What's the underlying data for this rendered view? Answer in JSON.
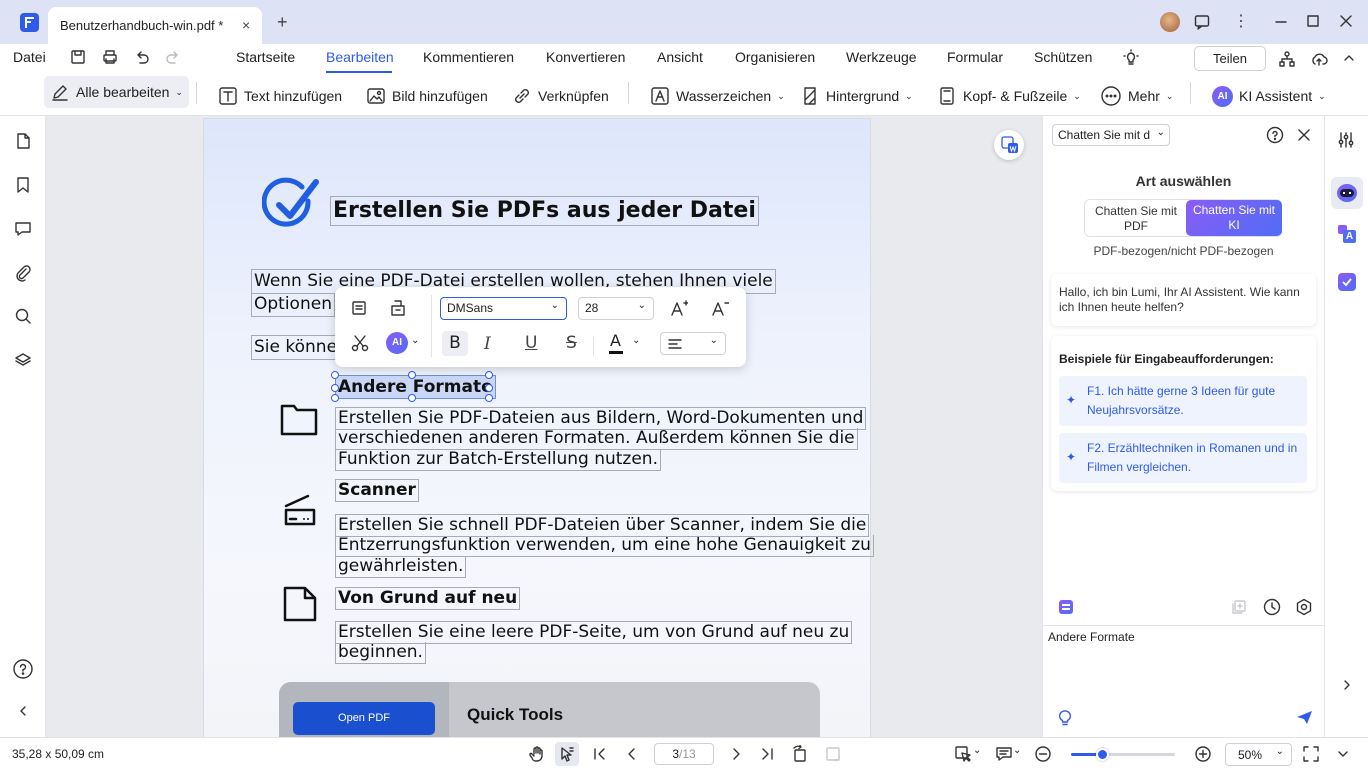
{
  "window": {
    "tab_title": "Benutzerhandbuch-win.pdf *",
    "tab_close": "×",
    "new_tab": "+"
  },
  "menu": {
    "file": "Datei",
    "items": [
      "Startseite",
      "Bearbeiten",
      "Kommentieren",
      "Konvertieren",
      "Ansicht",
      "Organisieren",
      "Werkzeuge",
      "Formular",
      "Schützen"
    ],
    "active": "Bearbeiten",
    "share": "Teilen"
  },
  "toolbar": {
    "edit_all": "Alle bearbeiten",
    "add_text": "Text hinzufügen",
    "add_image": "Bild hinzufügen",
    "link": "Verknüpfen",
    "watermark": "Wasserzeichen",
    "background": "Hintergrund",
    "header_footer": "Kopf- & Fußzeile",
    "more": "Mehr",
    "ai_assistant": "KI Assistent",
    "ai_badge": "AI"
  },
  "document": {
    "title": "Erstellen Sie PDFs aus jeder Datei",
    "intro_line1": "Wenn Sie eine PDF-Datei erstellen wollen, stehen Ihnen viele",
    "intro_line2": "Optionen",
    "intro_line3": "Sie könne",
    "sections": [
      {
        "heading": "Andere Formate",
        "lines": [
          "Erstellen Sie PDF-Dateien aus Bildern, Word-Dokumenten und",
          "verschiedenen anderen Formaten. Außerdem können Sie die",
          "Funktion zur Batch-Erstellung nutzen."
        ]
      },
      {
        "heading": "Scanner",
        "lines": [
          "Erstellen Sie schnell PDF-Dateien über Scanner, indem Sie die",
          "Entzerrungsfunktion verwenden, um eine hohe Genauigkeit zu",
          "gewährleisten."
        ]
      },
      {
        "heading": "Von Grund auf neu",
        "lines": [
          "Erstellen Sie eine leere PDF-Seite, um von Grund auf neu zu",
          "beginnen."
        ]
      }
    ],
    "quick_tools_title": "Quick Tools",
    "open_pdf_button": "Open PDF"
  },
  "format_toolbar": {
    "font": "DMSans",
    "size": "28",
    "ai_badge": "AI",
    "bold": "B",
    "italic": "I",
    "underline": "U",
    "strike": "S",
    "text_color": "A"
  },
  "ai_panel": {
    "mode_select": "Chatten Sie mit d",
    "choose_type": "Art auswählen",
    "option_pdf": "Chatten Sie mit PDF",
    "option_ai": "Chatten Sie mit KI",
    "subtitle": "PDF-bezogen/nicht PDF-bezogen",
    "greeting": "Hallo, ich bin Lumi, Ihr AI Assistent. Wie kann ich Ihnen heute helfen?",
    "examples_title": "Beispiele für Eingabeaufforderungen:",
    "examples": [
      "F1. Ich hätte gerne 3 Ideen für gute Neujahrsvorsätze.",
      "F2. Erzähltechniken in Romanen und in Filmen vergleichen."
    ],
    "input_value": "Andere Formate"
  },
  "status": {
    "dimensions": "35,28 x 50,09 cm",
    "current_page": "3",
    "total_pages": "/13",
    "zoom": "50%",
    "zoom_fraction": 0.3
  },
  "colors": {
    "accent": "#2f5bea",
    "ai_gradient_start": "#8b5cf6",
    "ai_gradient_end": "#4f6df5",
    "checkmark": "#1f5fe0",
    "open_pdf": "#1a4fd0"
  }
}
